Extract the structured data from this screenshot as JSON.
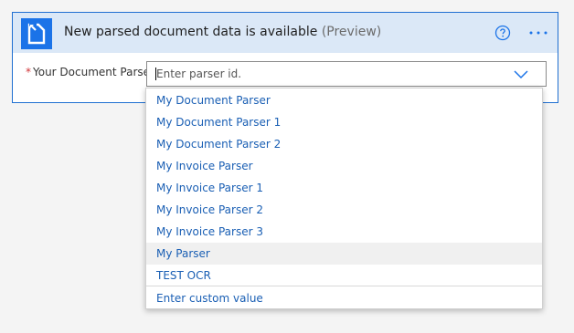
{
  "header": {
    "title": "New parsed document data is available",
    "title_suffix": "(Preview)",
    "help_icon": "help-circle-icon",
    "more_icon": "more-horizontal-icon",
    "app_icon": "document-parser-icon",
    "accent": "#1b73e8",
    "header_bg": "#dbe8f7"
  },
  "field": {
    "required_marker": "*",
    "label": "Your Document Parser",
    "placeholder": "Enter parser id.",
    "value": ""
  },
  "dropdown": {
    "options": [
      "My Document Parser",
      "My Document Parser 1",
      "My Document Parser 2",
      "My Invoice Parser",
      "My Invoice Parser 1",
      "My Invoice Parser 2",
      "My Invoice Parser 3",
      "My Parser",
      "TEST OCR"
    ],
    "hovered_option": "My Parser",
    "custom_value": "Enter custom value",
    "option_color": "#1a5fb4"
  }
}
